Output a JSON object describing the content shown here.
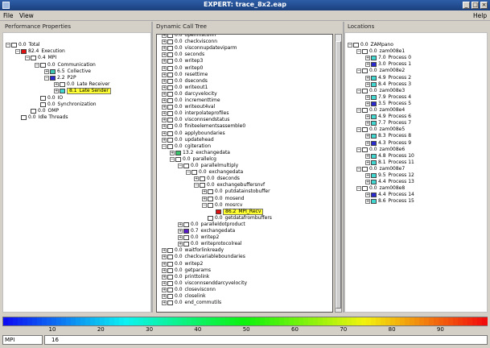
{
  "window": {
    "title": "EXPERT: trace_8x2.eap"
  },
  "menubar": {
    "file": "File",
    "view": "View",
    "help": "Help"
  },
  "panels": {
    "left_title": "Performance Properties",
    "mid_title": "Dynamic Call Tree",
    "right_title": "Locations"
  },
  "colors": {
    "red": "#e01010",
    "green": "#37c46a",
    "teal": "#3cc8b4",
    "blue": "#2a2ad0",
    "purple": "#5a1cc8",
    "white": "#ffffff",
    "yellow": "#ffff33",
    "cyan": "#40d8d0",
    "selection": "#ffff33"
  },
  "left_tree": [
    {
      "depth": 0,
      "exp": "-",
      "color": "white",
      "value": "0.0",
      "label": "Total"
    },
    {
      "depth": 1,
      "exp": "-",
      "color": "red",
      "value": "82.4",
      "label": "Execution"
    },
    {
      "depth": 2,
      "exp": "-",
      "color": "white",
      "value": "0.4",
      "label": "MPI"
    },
    {
      "depth": 3,
      "exp": "-",
      "color": "white",
      "value": "0.0",
      "label": "Communication"
    },
    {
      "depth": 4,
      "exp": "+",
      "color": "teal",
      "value": "6.5",
      "label": "Collective"
    },
    {
      "depth": 4,
      "exp": "-",
      "color": "blue",
      "value": "2.2",
      "label": "P2P"
    },
    {
      "depth": 5,
      "exp": "+",
      "color": "white",
      "value": "0.0",
      "label": "Late Receiver"
    },
    {
      "depth": 5,
      "exp": "+",
      "color": "cyan",
      "value": "8.1",
      "label": "Late Sender",
      "selected": true
    },
    {
      "depth": 3,
      "exp": "",
      "color": "white",
      "value": "0.0",
      "label": "IO"
    },
    {
      "depth": 3,
      "exp": "",
      "color": "white",
      "value": "0.0",
      "label": "Synchronization"
    },
    {
      "depth": 2,
      "exp": "",
      "color": "white",
      "value": "0.0",
      "label": "OMP"
    },
    {
      "depth": 1,
      "exp": "",
      "color": "white",
      "value": "0.0",
      "label": "Idle Threads"
    }
  ],
  "mid_tree": [
    {
      "depth": 0,
      "exp": "+",
      "color": "white",
      "value": "0.0",
      "label": "openmsconn"
    },
    {
      "depth": 0,
      "exp": "+",
      "color": "white",
      "value": "0.0",
      "label": "checkvisconn"
    },
    {
      "depth": 0,
      "exp": "+",
      "color": "white",
      "value": "0.0",
      "label": "visconnupdateviparm"
    },
    {
      "depth": 0,
      "exp": "+",
      "color": "white",
      "value": "0.0",
      "label": "seconds"
    },
    {
      "depth": 0,
      "exp": "+",
      "color": "white",
      "value": "0.0",
      "label": "writep3"
    },
    {
      "depth": 0,
      "exp": "+",
      "color": "white",
      "value": "0.0",
      "label": "writep0"
    },
    {
      "depth": 0,
      "exp": "+",
      "color": "white",
      "value": "0.0",
      "label": "resettime"
    },
    {
      "depth": 0,
      "exp": "+",
      "color": "white",
      "value": "0.0",
      "label": "dseconds"
    },
    {
      "depth": 0,
      "exp": "+",
      "color": "white",
      "value": "0.0",
      "label": "writeout1"
    },
    {
      "depth": 0,
      "exp": "+",
      "color": "white",
      "value": "0.0",
      "label": "darcyvelocity"
    },
    {
      "depth": 0,
      "exp": "+",
      "color": "white",
      "value": "0.0",
      "label": "incrementtime"
    },
    {
      "depth": 0,
      "exp": "+",
      "color": "white",
      "value": "0.0",
      "label": "writeout4val"
    },
    {
      "depth": 0,
      "exp": "+",
      "color": "white",
      "value": "0.0",
      "label": "interpolateprofiles"
    },
    {
      "depth": 0,
      "exp": "+",
      "color": "white",
      "value": "0.0",
      "label": "visconnsendstatus"
    },
    {
      "depth": 0,
      "exp": "+",
      "color": "white",
      "value": "0.0",
      "label": "finiteelementsassemble0"
    },
    {
      "depth": 0,
      "exp": "+",
      "color": "white",
      "value": "0.0",
      "label": "applyboundaries"
    },
    {
      "depth": 0,
      "exp": "+",
      "color": "white",
      "value": "0.0",
      "label": "updatehead"
    },
    {
      "depth": 0,
      "exp": "-",
      "color": "white",
      "value": "0.0",
      "label": "cgiteration"
    },
    {
      "depth": 1,
      "exp": "+",
      "color": "green",
      "value": "13.2",
      "label": "exchangedata"
    },
    {
      "depth": 1,
      "exp": "-",
      "color": "white",
      "value": "0.0",
      "label": "parallelcg"
    },
    {
      "depth": 2,
      "exp": "-",
      "color": "white",
      "value": "0.0",
      "label": "parallelmultiply"
    },
    {
      "depth": 3,
      "exp": "-",
      "color": "white",
      "value": "0.0",
      "label": "exchangedata"
    },
    {
      "depth": 4,
      "exp": "+",
      "color": "white",
      "value": "0.0",
      "label": "dseconds"
    },
    {
      "depth": 4,
      "exp": "-",
      "color": "white",
      "value": "0.0",
      "label": "exchangebuffersnvf"
    },
    {
      "depth": 5,
      "exp": "+",
      "color": "white",
      "value": "0.0",
      "label": "putdatainstobuffer"
    },
    {
      "depth": 5,
      "exp": "+",
      "color": "white",
      "value": "0.0",
      "label": "mosend"
    },
    {
      "depth": 5,
      "exp": "-",
      "color": "white",
      "value": "0.0",
      "label": "mosrcv"
    },
    {
      "depth": 6,
      "exp": "",
      "color": "red",
      "value": "86.2",
      "label": "MPI_Recv",
      "selected": true
    },
    {
      "depth": 5,
      "exp": "",
      "color": "white",
      "value": "0.0",
      "label": "getdatafrombuffers"
    },
    {
      "depth": 2,
      "exp": "+",
      "color": "white",
      "value": "0.0",
      "label": "paralleldotproduct"
    },
    {
      "depth": 2,
      "exp": "+",
      "color": "purple",
      "value": "0.7",
      "label": "exchangedata"
    },
    {
      "depth": 2,
      "exp": "+",
      "color": "white",
      "value": "0.0",
      "label": "writep2"
    },
    {
      "depth": 2,
      "exp": "+",
      "color": "white",
      "value": "0.0",
      "label": "writeprotocolreal"
    },
    {
      "depth": 0,
      "exp": "+",
      "color": "white",
      "value": "0.0",
      "label": "waitforlinkready"
    },
    {
      "depth": 0,
      "exp": "+",
      "color": "white",
      "value": "0.0",
      "label": "checkvariableboundaries"
    },
    {
      "depth": 0,
      "exp": "+",
      "color": "white",
      "value": "0.0",
      "label": "writep2"
    },
    {
      "depth": 0,
      "exp": "+",
      "color": "white",
      "value": "0.0",
      "label": "getparams"
    },
    {
      "depth": 0,
      "exp": "+",
      "color": "white",
      "value": "0.0",
      "label": "printtolink"
    },
    {
      "depth": 0,
      "exp": "+",
      "color": "white",
      "value": "0.0",
      "label": "visconnsenddarcyvelocity"
    },
    {
      "depth": 0,
      "exp": "+",
      "color": "white",
      "value": "0.0",
      "label": "closevisconn"
    },
    {
      "depth": 0,
      "exp": "+",
      "color": "white",
      "value": "0.0",
      "label": "closelink"
    },
    {
      "depth": 0,
      "exp": "+",
      "color": "white",
      "value": "0.0",
      "label": "end_commutils"
    }
  ],
  "right_tree": [
    {
      "depth": 0,
      "exp": "-",
      "color": "white",
      "value": "0.0",
      "label": "ZAMpano"
    },
    {
      "depth": 1,
      "exp": "-",
      "color": "white",
      "value": "0.0",
      "label": "zam008e1"
    },
    {
      "depth": 2,
      "exp": "+",
      "color": "cyan",
      "value": "7.0",
      "label": "Process 0"
    },
    {
      "depth": 2,
      "exp": "+",
      "color": "blue",
      "value": "3.0",
      "label": "Process 1"
    },
    {
      "depth": 1,
      "exp": "-",
      "color": "white",
      "value": "0.0",
      "label": "zam008e2"
    },
    {
      "depth": 2,
      "exp": "+",
      "color": "cyan",
      "value": "4.9",
      "label": "Process 2"
    },
    {
      "depth": 2,
      "exp": "+",
      "color": "cyan",
      "value": "8.4",
      "label": "Process 3"
    },
    {
      "depth": 1,
      "exp": "-",
      "color": "white",
      "value": "0.0",
      "label": "zam008e3"
    },
    {
      "depth": 2,
      "exp": "+",
      "color": "cyan",
      "value": "7.9",
      "label": "Process 4"
    },
    {
      "depth": 2,
      "exp": "+",
      "color": "blue",
      "value": "3.5",
      "label": "Process 5"
    },
    {
      "depth": 1,
      "exp": "-",
      "color": "white",
      "value": "0.0",
      "label": "zam008e4"
    },
    {
      "depth": 2,
      "exp": "+",
      "color": "cyan",
      "value": "4.9",
      "label": "Process 6"
    },
    {
      "depth": 2,
      "exp": "+",
      "color": "cyan",
      "value": "7.7",
      "label": "Process 7"
    },
    {
      "depth": 1,
      "exp": "-",
      "color": "white",
      "value": "0.0",
      "label": "zam008e5"
    },
    {
      "depth": 2,
      "exp": "+",
      "color": "cyan",
      "value": "8.3",
      "label": "Process 8"
    },
    {
      "depth": 2,
      "exp": "+",
      "color": "blue",
      "value": "4.3",
      "label": "Process 9"
    },
    {
      "depth": 1,
      "exp": "-",
      "color": "white",
      "value": "0.0",
      "label": "zam008e6"
    },
    {
      "depth": 2,
      "exp": "+",
      "color": "cyan",
      "value": "4.8",
      "label": "Process 10"
    },
    {
      "depth": 2,
      "exp": "+",
      "color": "cyan",
      "value": "8.1",
      "label": "Process 11"
    },
    {
      "depth": 1,
      "exp": "-",
      "color": "white",
      "value": "0.0",
      "label": "zam008e7"
    },
    {
      "depth": 2,
      "exp": "+",
      "color": "cyan",
      "value": "9.5",
      "label": "Process 12"
    },
    {
      "depth": 2,
      "exp": "+",
      "color": "cyan",
      "value": "4.4",
      "label": "Process 13"
    },
    {
      "depth": 1,
      "exp": "-",
      "color": "white",
      "value": "0.0",
      "label": "zam008e8"
    },
    {
      "depth": 2,
      "exp": "+",
      "color": "blue",
      "value": "4.4",
      "label": "Process 14"
    },
    {
      "depth": 2,
      "exp": "+",
      "color": "cyan",
      "value": "8.6",
      "label": "Process 15"
    }
  ],
  "scale": {
    "ticks": [
      "10",
      "20",
      "30",
      "40",
      "50",
      "60",
      "70",
      "80",
      "90"
    ]
  },
  "status": {
    "field1": "MPI",
    "field2": "16"
  }
}
